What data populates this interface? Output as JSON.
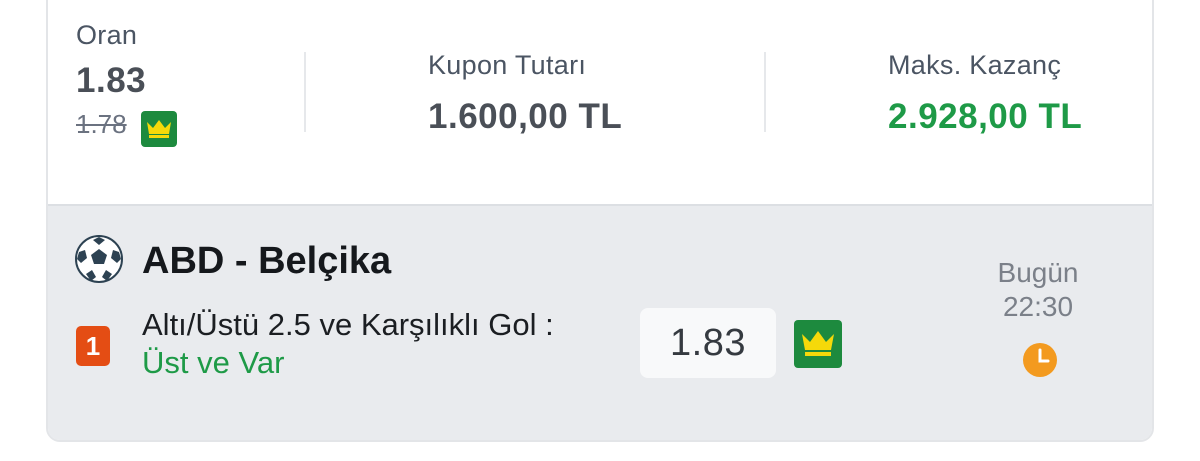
{
  "summary": {
    "odds_label": "Oran",
    "odds_value": "1.83",
    "old_odds": "1.78",
    "stake_label": "Kupon Tutarı",
    "stake_value": "1.600,00 TL",
    "max_win_label": "Maks. Kazanç",
    "max_win_value": "2.928,00 TL"
  },
  "match": {
    "teams": "ABD - Belçika",
    "pick_number": "1",
    "market_text": "Altı/Üstü 2.5 ve Karşılıklı Gol : ",
    "selection": "Üst ve Var",
    "odds": "1.83",
    "day": "Bugün",
    "time": "22:30"
  },
  "icons": {
    "crown": "crown-icon",
    "ball": "soccer-ball-icon",
    "clock": "clock-icon"
  },
  "colors": {
    "green": "#1e9a47",
    "badge_green": "#1d8a3e",
    "pick_orange": "#e44d14",
    "clock_orange": "#f39a1f"
  }
}
